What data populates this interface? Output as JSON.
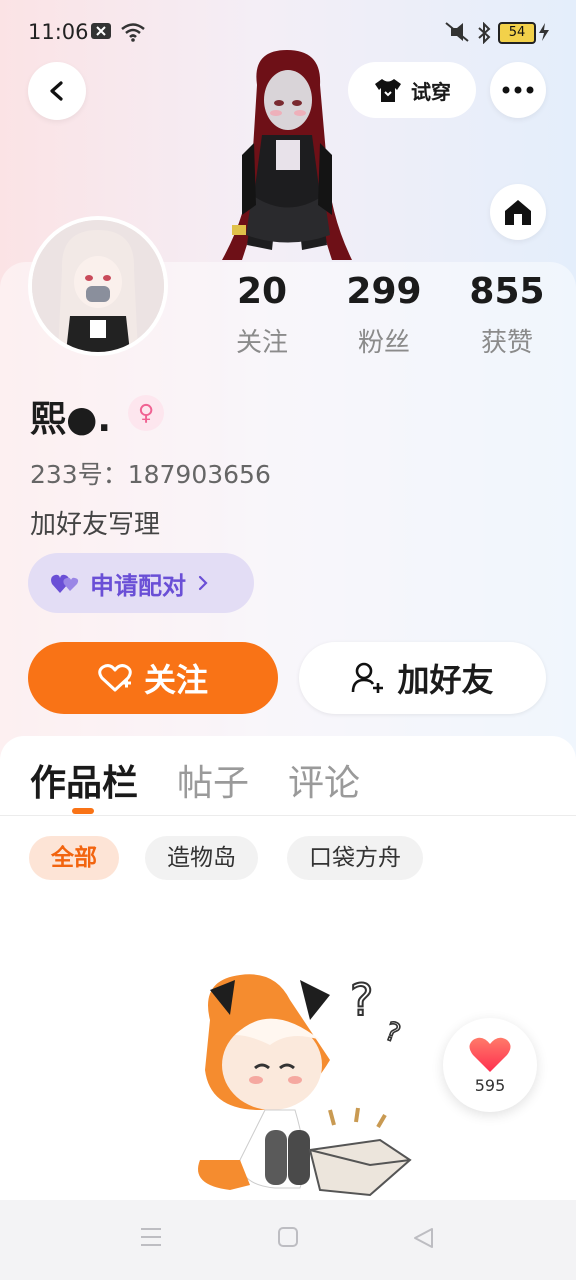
{
  "status_bar": {
    "time": "11:06",
    "battery": "54"
  },
  "header": {
    "tryon_label": "试穿"
  },
  "stats": [
    {
      "value": "20",
      "label": "关注"
    },
    {
      "value": "299",
      "label": "粉丝"
    },
    {
      "value": "855",
      "label": "获赞"
    }
  ],
  "profile": {
    "nickname": "熙●.",
    "gender_symbol": "♀",
    "uid": "233号：187903656",
    "signature": "加好友写理"
  },
  "actions": {
    "pair_label": "申请配对",
    "follow_label": "关注",
    "add_friend_label": "加好友"
  },
  "tabs": [
    {
      "label": "作品栏",
      "active": true
    },
    {
      "label": "帖子",
      "active": false
    },
    {
      "label": "评论",
      "active": false
    }
  ],
  "filters": [
    {
      "label": "全部",
      "active": true
    },
    {
      "label": "造物岛",
      "active": false
    },
    {
      "label": "口袋方舟",
      "active": false
    }
  ],
  "like_float": {
    "count": "595"
  },
  "colors": {
    "accent": "#f97316",
    "pair": "#6a4fd6",
    "like": "#ff4d5e"
  }
}
